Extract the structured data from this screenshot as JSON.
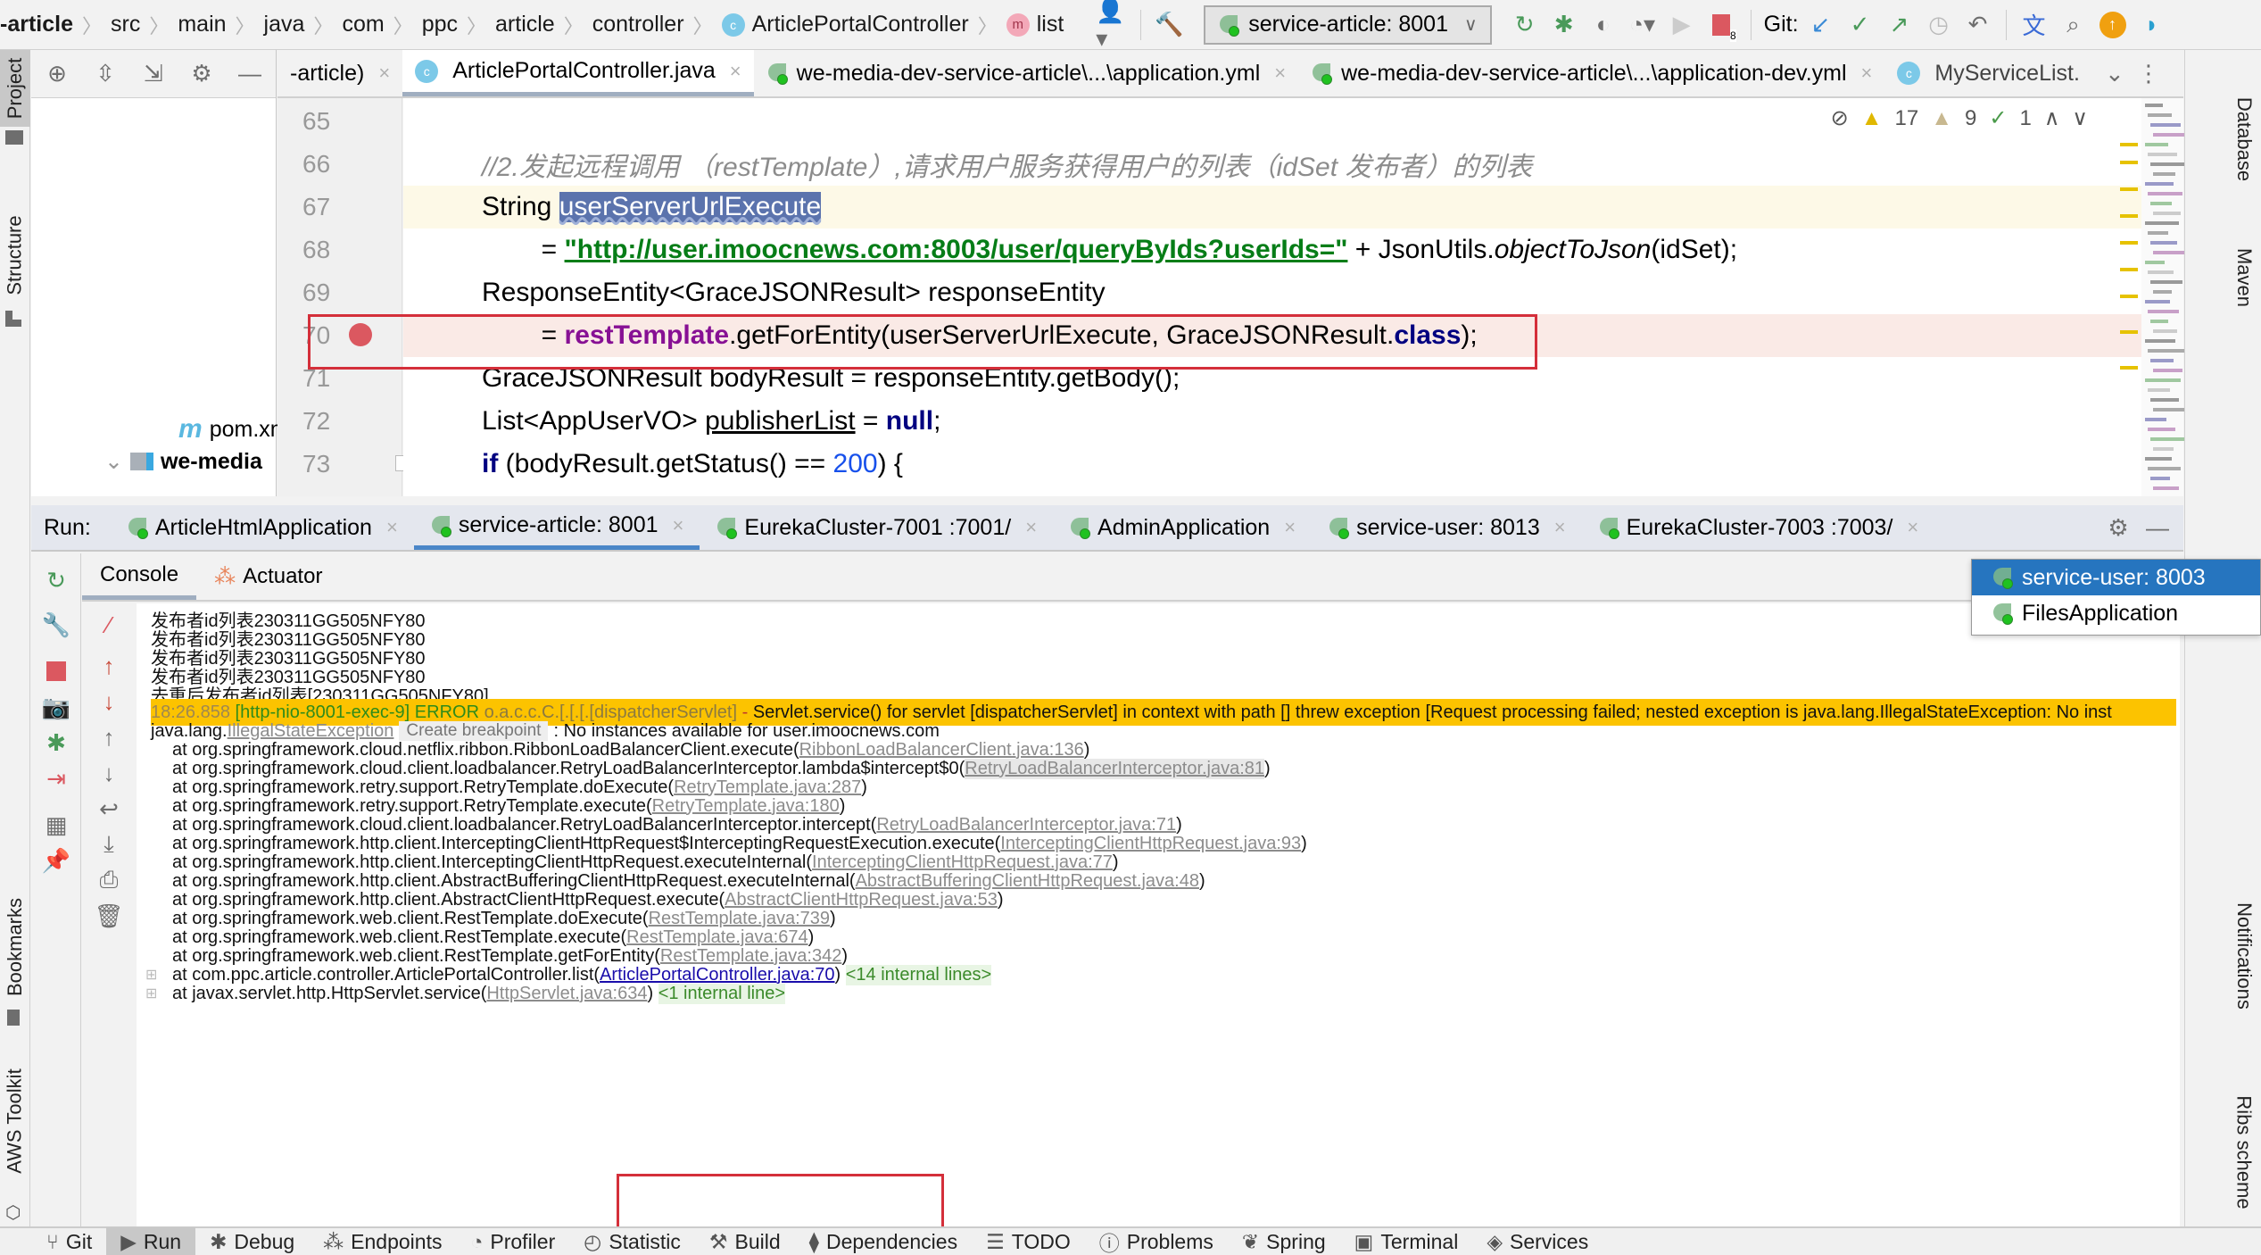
{
  "breadcrumb": [
    "-article",
    "src",
    "main",
    "java",
    "com",
    "ppc",
    "article",
    "controller",
    "ArticlePortalController",
    "list"
  ],
  "toolbar": {
    "run_config": "service-article: 8001",
    "git_label": "Git:",
    "stop_badge": "8"
  },
  "project_pane": {
    "tree": [
      {
        "label": "pom.xml",
        "icon": "maven-icon"
      },
      {
        "label": "we-media",
        "icon": "module-folder-icon",
        "expanded": true
      }
    ]
  },
  "left_strip": {
    "project": "Project",
    "structure": "Structure",
    "bookmarks": "Bookmarks",
    "aws": "AWS Toolkit"
  },
  "right_strip": {
    "database": "Database",
    "maven": "Maven",
    "notifications": "Notifications",
    "ribs": "Ribs scheme"
  },
  "editor_tabs": [
    {
      "label": "-article)",
      "icon": "none",
      "active": false
    },
    {
      "label": "ArticlePortalController.java",
      "icon": "class-icon",
      "active": true
    },
    {
      "label": "we-media-dev-service-article\\...\\application.yml",
      "icon": "spring-icon",
      "active": false
    },
    {
      "label": "we-media-dev-service-article\\...\\application-dev.yml",
      "icon": "spring-icon",
      "active": false
    },
    {
      "label": "MyServiceList.",
      "icon": "class-icon",
      "active": false
    }
  ],
  "inspections": {
    "warnings": "17",
    "weak_warnings": "9",
    "typos": "1"
  },
  "code_lines": [
    {
      "num": "65",
      "parts": []
    },
    {
      "num": "66",
      "parts": [
        {
          "t": "//2.发起远程调用 （restTemplate）,请求用户服务获得用户的列表（idSet 发布者）的列表",
          "c": "cmt"
        }
      ]
    },
    {
      "num": "67",
      "parts": [
        {
          "t": "String ",
          "c": ""
        },
        {
          "t": "userServerUrlExecute",
          "c": "sel"
        }
      ]
    },
    {
      "num": "68",
      "parts": [
        {
          "t": "        = ",
          "c": ""
        },
        {
          "t": "\"http://user.imoocnews.com:8003/user/queryByIds?userIds=\"",
          "c": "str"
        },
        {
          "t": " + JsonUtils.",
          "c": ""
        },
        {
          "t": "objectToJson",
          "c": "ital"
        },
        {
          "t": "(idSet);",
          "c": ""
        }
      ]
    },
    {
      "num": "69",
      "parts": [
        {
          "t": "ResponseEntity<GraceJSONResult> responseEntity",
          "c": ""
        }
      ]
    },
    {
      "num": "70",
      "parts": [
        {
          "t": "        = ",
          "c": ""
        },
        {
          "t": "restTemplate",
          "c": "fld"
        },
        {
          "t": ".getForEntity(userServerUrlExecute, GraceJSONResult.",
          "c": ""
        },
        {
          "t": "class",
          "c": "kw"
        },
        {
          "t": ");",
          "c": ""
        }
      ]
    },
    {
      "num": "71",
      "parts": [
        {
          "t": "GraceJSONResult bodyResult = responseEntity.getBody();",
          "c": ""
        }
      ]
    },
    {
      "num": "72",
      "parts": [
        {
          "t": "List<AppUserVO> ",
          "c": ""
        },
        {
          "t": "publisherList",
          "c": "ul"
        },
        {
          "t": " = ",
          "c": ""
        },
        {
          "t": "null",
          "c": "kw"
        },
        {
          "t": ";",
          "c": ""
        }
      ]
    },
    {
      "num": "73",
      "parts": [
        {
          "t": "if",
          "c": "kw"
        },
        {
          "t": " (bodyResult.getStatus() == ",
          "c": ""
        },
        {
          "t": "200",
          "c": "num"
        },
        {
          "t": ") {",
          "c": ""
        }
      ]
    }
  ],
  "run_panel": {
    "label": "Run:",
    "tabs": [
      {
        "label": "ArticleHtmlApplication",
        "active": false
      },
      {
        "label": "service-article: 8001",
        "active": true
      },
      {
        "label": "EurekaCluster-7001 :7001/",
        "active": false
      },
      {
        "label": "AdminApplication",
        "active": false
      },
      {
        "label": "service-user: 8013",
        "active": false
      },
      {
        "label": "EurekaCluster-7003 :7003/",
        "active": false
      }
    ],
    "console_tab": "Console",
    "actuator_tab": "Actuator",
    "overflow_popup": [
      {
        "label": "service-user: 8003",
        "selected": true
      },
      {
        "label": "FilesApplication",
        "selected": false
      }
    ]
  },
  "console": {
    "plain_lines": [
      "发布者id列表230311GG505NFY80",
      "发布者id列表230311GG505NFY80",
      "发布者id列表230311GG505NFY80",
      "发布者id列表230311GG505NFY80",
      "去重后发布者id列表[230311GG505NFY80]"
    ],
    "error_line": {
      "timestamp": "18:26.858",
      "thread": "[http-nio-8001-exec-9]",
      "level": "ERROR",
      "logger": "o.a.c.c.C.[.[.[.[dispatcherServlet]",
      "dash": " - ",
      "message": "Servlet.service() for servlet [dispatcherServlet] in context with path [] threw exception [Request processing failed; nested exception is java.lang.IllegalStateException: No inst"
    },
    "exception": {
      "prefix": "java.lang.",
      "class": "IllegalStateException",
      "chip": "Create breakpoint",
      "message": ": No instances available for user.imoocnews.com"
    },
    "stack": [
      {
        "at": "at org.springframework.cloud.netflix.ribbon.RibbonLoadBalancerClient.execute(",
        "link": "RibbonLoadBalancerClient.java:136",
        "end": ")"
      },
      {
        "at": "at org.springframework.cloud.client.loadbalancer.RetryLoadBalancerInterceptor.lambda$intercept$0(",
        "link": "RetryLoadBalancerInterceptor.java:81",
        "end": ")"
      },
      {
        "at": "at org.springframework.retry.support.RetryTemplate.doExecute(",
        "link": "RetryTemplate.java:287",
        "end": ")"
      },
      {
        "at": "at org.springframework.retry.support.RetryTemplate.execute(",
        "link": "RetryTemplate.java:180",
        "end": ")"
      },
      {
        "at": "at org.springframework.cloud.client.loadbalancer.RetryLoadBalancerInterceptor.intercept(",
        "link": "RetryLoadBalancerInterceptor.java:71",
        "end": ")"
      },
      {
        "at": "at org.springframework.http.client.InterceptingClientHttpRequest$InterceptingRequestExecution.execute(",
        "link": "InterceptingClientHttpRequest.java:93",
        "end": ")"
      },
      {
        "at": "at org.springframework.http.client.InterceptingClientHttpRequest.executeInternal(",
        "link": "InterceptingClientHttpRequest.java:77",
        "end": ")"
      },
      {
        "at": "at org.springframework.http.client.AbstractBufferingClientHttpRequest.executeInternal(",
        "link": "AbstractBufferingClientHttpRequest.java:48",
        "end": ")"
      },
      {
        "at": "at org.springframework.http.client.AbstractClientHttpRequest.execute(",
        "link": "AbstractClientHttpRequest.java:53",
        "end": ")"
      },
      {
        "at": "at org.springframework.web.client.RestTemplate.doExecute(",
        "link": "RestTemplate.java:739",
        "end": ")"
      },
      {
        "at": "at org.springframework.web.client.RestTemplate.execute(",
        "link": "RestTemplate.java:674",
        "end": ")"
      },
      {
        "at": "at org.springframework.web.client.RestTemplate.getForEntity(",
        "link": "RestTemplate.java:342",
        "end": ")"
      }
    ],
    "controller_frame": {
      "at": "at com.ppc.article.controller.ArticlePortalController.list(",
      "link": "ArticlePortalController.java:70",
      "end": ") ",
      "internal": "<14 internal lines>"
    },
    "servlet_frame": {
      "at": "at javax.servlet.http.HttpServlet.service(",
      "link": "HttpServlet.java:634",
      "end": ") ",
      "internal": "<1 internal line>"
    }
  },
  "bottom_bar": [
    {
      "label": "Git",
      "icon": "git-branch-icon",
      "active": false
    },
    {
      "label": "Run",
      "icon": "run-icon",
      "active": true
    },
    {
      "label": "Debug",
      "icon": "bug-icon",
      "active": false
    },
    {
      "label": "Endpoints",
      "icon": "endpoints-icon",
      "active": false
    },
    {
      "label": "Profiler",
      "icon": "profiler-icon",
      "active": false
    },
    {
      "label": "Statistic",
      "icon": "statistic-icon",
      "active": false
    },
    {
      "label": "Build",
      "icon": "hammer-icon",
      "active": false
    },
    {
      "label": "Dependencies",
      "icon": "dependencies-icon",
      "active": false
    },
    {
      "label": "TODO",
      "icon": "list-icon",
      "active": false
    },
    {
      "label": "Problems",
      "icon": "problems-icon",
      "active": false
    },
    {
      "label": "Spring",
      "icon": "spring-leaf-icon",
      "active": false
    },
    {
      "label": "Terminal",
      "icon": "terminal-icon",
      "active": false
    },
    {
      "label": "Services",
      "icon": "services-icon",
      "active": false
    }
  ],
  "colors": {
    "accent_tab": "#4a86c8",
    "error_bar": "#fcc300",
    "breakpoint": "#db5860",
    "highlight_box": "#d42f3a",
    "selection": "#5b73ad"
  }
}
